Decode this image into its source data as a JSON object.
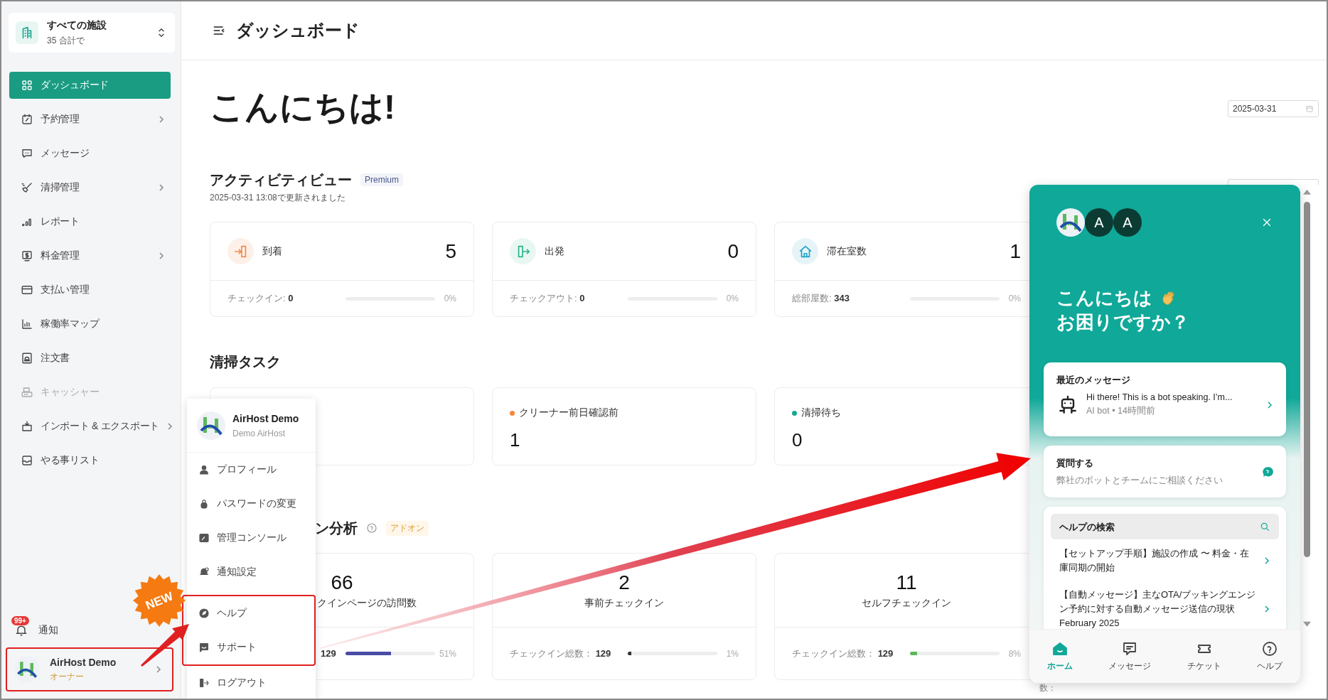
{
  "property_selector": {
    "title": "すべての施設",
    "subtitle": "35 合計で"
  },
  "sidebar": {
    "items": [
      {
        "label": "ダッシュボード",
        "selected": true,
        "submenu": false,
        "disabled": false
      },
      {
        "label": "予約管理",
        "selected": false,
        "submenu": true,
        "disabled": false
      },
      {
        "label": "メッセージ",
        "selected": false,
        "submenu": false,
        "disabled": false
      },
      {
        "label": "清掃管理",
        "selected": false,
        "submenu": true,
        "disabled": false
      },
      {
        "label": "レポート",
        "selected": false,
        "submenu": false,
        "disabled": false
      },
      {
        "label": "料金管理",
        "selected": false,
        "submenu": true,
        "disabled": false
      },
      {
        "label": "支払い管理",
        "selected": false,
        "submenu": false,
        "disabled": false
      },
      {
        "label": "稼働率マップ",
        "selected": false,
        "submenu": false,
        "disabled": false
      },
      {
        "label": "注文書",
        "selected": false,
        "submenu": false,
        "disabled": false
      },
      {
        "label": "キャッシャー",
        "selected": false,
        "submenu": false,
        "disabled": true
      },
      {
        "label": "インポート & エクスポート",
        "selected": false,
        "submenu": true,
        "disabled": false
      },
      {
        "label": "やる事リスト",
        "selected": false,
        "submenu": false,
        "disabled": false
      }
    ],
    "notification": {
      "label": "通知",
      "badge": "99+"
    },
    "user": {
      "name": "AirHost Demo",
      "role": "オーナー",
      "highlighted": true
    }
  },
  "header": {
    "title": "ダッシュボード"
  },
  "greeting": "こんにちは!",
  "date_field": {
    "value": "2025-03-31"
  },
  "activity": {
    "title": "アクティビティビュー",
    "badge": "Premium",
    "updated": "2025-03-31 13:08で更新されました",
    "cards": [
      {
        "kind": "arrival",
        "label": "到着",
        "value": "5",
        "footer": "チェックイン: **0**",
        "level": 0,
        "percent": "0%"
      },
      {
        "kind": "departure",
        "label": "出発",
        "value": "0",
        "footer": "チェックアウト: **0**",
        "level": 0,
        "percent": "0%"
      },
      {
        "kind": "stay",
        "label": "滞在室数",
        "value": "1",
        "footer": "総部屋数: **343**",
        "level": 0,
        "percent": "0%"
      }
    ]
  },
  "cleaning": {
    "title": "清掃タスク",
    "cards": [
      {
        "kind": "covered"
      },
      {
        "kind": "status",
        "label": "クリーナー前日確認前",
        "value": "1",
        "color": "#f5873d"
      },
      {
        "kind": "status",
        "label": "清掃待ち",
        "value": "0",
        "color": "#17a88f"
      }
    ]
  },
  "analysis": {
    "title": "ン分析",
    "badge": "アドオン",
    "cards": [
      {
        "kind": "covered",
        "value": "66",
        "label": "クインページの訪問数",
        "footer": "129",
        "level": 0.51,
        "percent": "51%",
        "color": "#4b4ba8"
      },
      {
        "kind": "plain",
        "value": "2",
        "label": "事前チェックイン",
        "footer": "チェックイン総数： **129**",
        "level": 0.01,
        "percent": "1%",
        "color": "#333333"
      },
      {
        "kind": "plain",
        "value": "11",
        "label": "セルフチェックイン",
        "footer": "チェックイン総数： **129**",
        "level": 0.08,
        "percent": "8%",
        "color": "#5cb85c"
      }
    ],
    "cut_label": "数："
  },
  "user_menu": {
    "name": "AirHost Demo",
    "subtitle": "Demo AirHost",
    "items": [
      {
        "label": "プロフィール",
        "highlighted": false
      },
      {
        "label": "パスワードの変更",
        "highlighted": false
      },
      {
        "label": "管理コンソール",
        "highlighted": false
      },
      {
        "label": "通知設定",
        "highlighted": false
      },
      {
        "label": "ヘルプ",
        "highlighted": true
      },
      {
        "label": "サポート",
        "highlighted": true
      },
      {
        "label": "ログアウト",
        "highlighted": false
      }
    ]
  },
  "new_badge": "NEW",
  "chat": {
    "avatars": [
      "A",
      "A"
    ],
    "greeting": [
      "こんにちは",
      "お困りですか？"
    ],
    "recent": {
      "title": "最近のメッセージ",
      "message": "Hi there! This is a bot speaking. I’m...",
      "meta": "AI bot • 14時間前"
    },
    "ask": {
      "title": "質問する",
      "subtitle": "弊社のボットとチームにご相談ください"
    },
    "help": {
      "placeholder": "ヘルプの検索",
      "articles": [
        "【セットアップ手順】施設の作成 〜 料金・在庫同期の開始",
        "【自動メッセージ】主なOTA/ブッキングエンジン予約に対する自動メッセージ送信の現状　February 2025"
      ]
    },
    "tabs": [
      {
        "label": "ホーム",
        "selected": true
      },
      {
        "label": "メッセージ",
        "selected": false
      },
      {
        "label": "チケット",
        "selected": false
      },
      {
        "label": "ヘルプ",
        "selected": false
      }
    ]
  }
}
